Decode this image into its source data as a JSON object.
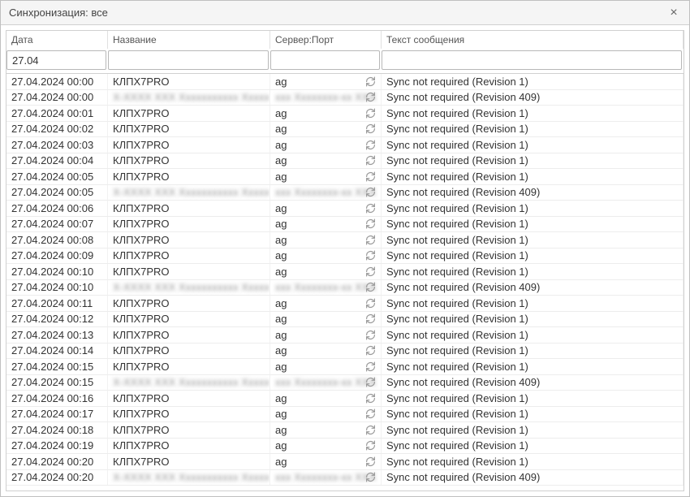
{
  "window": {
    "title": "Синхронизация: все",
    "close_label": "×"
  },
  "columns": {
    "date": "Дата",
    "name": "Название",
    "server": "Сервер:Порт",
    "message": "Текст сообщения"
  },
  "filters": {
    "date": "27.04",
    "name": "",
    "server": "",
    "message": ""
  },
  "rows": [
    {
      "date": "27.04.2024  00:00",
      "name": "КЛПХ7PRO",
      "server": "ag",
      "msg": "Sync not required (Revision 1)",
      "blurred": false
    },
    {
      "date": "27.04.2024  00:00",
      "name": "X-XXXX  XXX Xxxxxxxxxxx Xxxxx",
      "server": "xxx Xxxxxxxx-xx XXX",
      "msg": "Sync not required (Revision 409)",
      "blurred": true
    },
    {
      "date": "27.04.2024  00:01",
      "name": "КЛПХ7PRO",
      "server": "ag",
      "msg": "Sync not required (Revision 1)",
      "blurred": false
    },
    {
      "date": "27.04.2024  00:02",
      "name": "КЛПХ7PRO",
      "server": "ag",
      "msg": "Sync not required (Revision 1)",
      "blurred": false
    },
    {
      "date": "27.04.2024  00:03",
      "name": "КЛПХ7PRO",
      "server": "ag",
      "msg": "Sync not required (Revision 1)",
      "blurred": false
    },
    {
      "date": "27.04.2024  00:04",
      "name": "КЛПХ7PRO",
      "server": "ag",
      "msg": "Sync not required (Revision 1)",
      "blurred": false
    },
    {
      "date": "27.04.2024  00:05",
      "name": "КЛПХ7PRO",
      "server": "ag",
      "msg": "Sync not required (Revision 1)",
      "blurred": false
    },
    {
      "date": "27.04.2024  00:05",
      "name": "X-XXXX  XXX Xxxxxxxxxxx Xxxxx",
      "server": "xxx Xxxxxxxx-xx XXX",
      "msg": "Sync not required (Revision 409)",
      "blurred": true
    },
    {
      "date": "27.04.2024  00:06",
      "name": "КЛПХ7PRO",
      "server": "ag",
      "msg": "Sync not required (Revision 1)",
      "blurred": false
    },
    {
      "date": "27.04.2024  00:07",
      "name": "КЛПХ7PRO",
      "server": "ag",
      "msg": "Sync not required (Revision 1)",
      "blurred": false
    },
    {
      "date": "27.04.2024  00:08",
      "name": "КЛПХ7PRO",
      "server": "ag",
      "msg": "Sync not required (Revision 1)",
      "blurred": false
    },
    {
      "date": "27.04.2024  00:09",
      "name": "КЛПХ7PRO",
      "server": "ag",
      "msg": "Sync not required (Revision 1)",
      "blurred": false
    },
    {
      "date": "27.04.2024  00:10",
      "name": "КЛПХ7PRO",
      "server": "ag",
      "msg": "Sync not required (Revision 1)",
      "blurred": false
    },
    {
      "date": "27.04.2024  00:10",
      "name": "X-XXXX  XXX Xxxxxxxxxxx Xxxxx",
      "server": "xxx Xxxxxxxx-xx XXX",
      "msg": "Sync not required (Revision 409)",
      "blurred": true
    },
    {
      "date": "27.04.2024  00:11",
      "name": "КЛПХ7PRO",
      "server": "ag",
      "msg": "Sync not required (Revision 1)",
      "blurred": false
    },
    {
      "date": "27.04.2024  00:12",
      "name": "КЛПХ7PRO",
      "server": "ag",
      "msg": "Sync not required (Revision 1)",
      "blurred": false
    },
    {
      "date": "27.04.2024  00:13",
      "name": "КЛПХ7PRO",
      "server": "ag",
      "msg": "Sync not required (Revision 1)",
      "blurred": false
    },
    {
      "date": "27.04.2024  00:14",
      "name": "КЛПХ7PRO",
      "server": "ag",
      "msg": "Sync not required (Revision 1)",
      "blurred": false
    },
    {
      "date": "27.04.2024  00:15",
      "name": "КЛПХ7PRO",
      "server": "ag",
      "msg": "Sync not required (Revision 1)",
      "blurred": false
    },
    {
      "date": "27.04.2024  00:15",
      "name": "X-XXXX  XXX Xxxxxxxxxxx Xxxxx",
      "server": "xxx Xxxxxxxx-xx XXX",
      "msg": "Sync not required (Revision 409)",
      "blurred": true
    },
    {
      "date": "27.04.2024  00:16",
      "name": "КЛПХ7PRO",
      "server": "ag",
      "msg": "Sync not required (Revision 1)",
      "blurred": false
    },
    {
      "date": "27.04.2024  00:17",
      "name": "КЛПХ7PRO",
      "server": "ag",
      "msg": "Sync not required (Revision 1)",
      "blurred": false
    },
    {
      "date": "27.04.2024  00:18",
      "name": "КЛПХ7PRO",
      "server": "ag",
      "msg": "Sync not required (Revision 1)",
      "blurred": false
    },
    {
      "date": "27.04.2024  00:19",
      "name": "КЛПХ7PRO",
      "server": "ag",
      "msg": "Sync not required (Revision 1)",
      "blurred": false
    },
    {
      "date": "27.04.2024  00:20",
      "name": "КЛПХ7PRO",
      "server": "ag",
      "msg": "Sync not required (Revision 1)",
      "blurred": false
    },
    {
      "date": "27.04.2024  00:20",
      "name": "X-XXXX  XXX Xxxxxxxxxxx Xxxxx",
      "server": "xxx Xxxxxxxx-xx XXX",
      "msg": "Sync not required (Revision 409)",
      "blurred": true
    }
  ]
}
